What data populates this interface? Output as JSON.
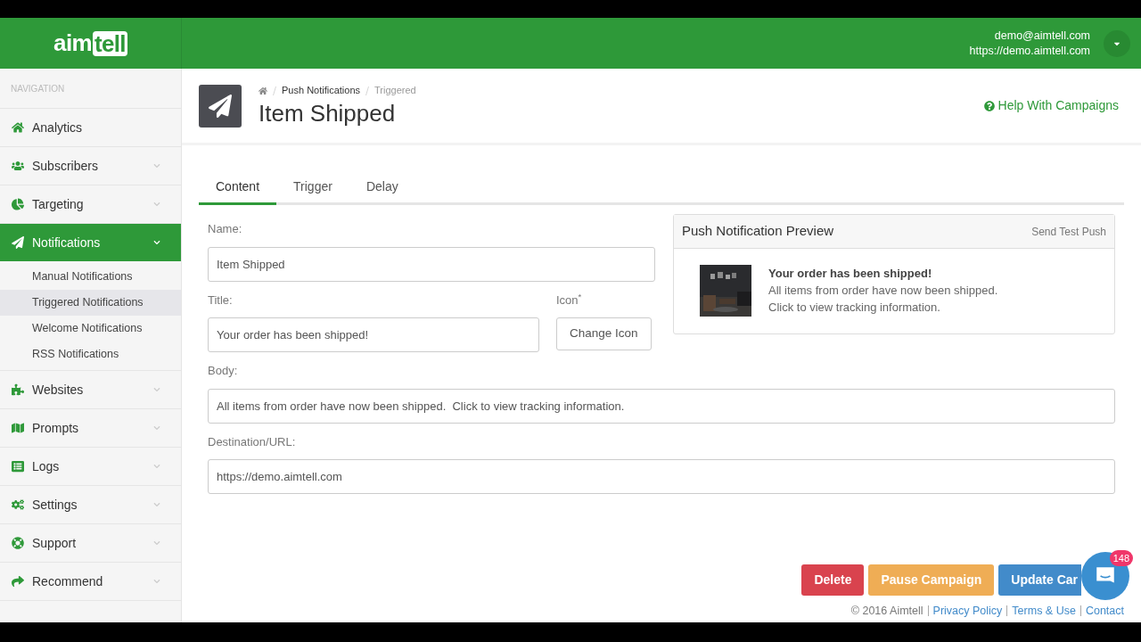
{
  "header": {
    "logo": {
      "part_1": "aim",
      "part_2": "tell"
    },
    "user_email": "demo@aimtell.com",
    "user_site": "https://demo.aimtell.com"
  },
  "sidebar": {
    "heading": "NAVIGATION",
    "items": [
      {
        "label": "Analytics",
        "expandable": false,
        "selected": false
      },
      {
        "label": "Subscribers",
        "expandable": true,
        "selected": false
      },
      {
        "label": "Targeting",
        "expandable": true,
        "selected": false
      },
      {
        "label": "Notifications",
        "expandable": true,
        "selected": true,
        "children": [
          {
            "label": "Manual Notifications",
            "selected": false
          },
          {
            "label": "Triggered Notifications",
            "selected": true
          },
          {
            "label": "Welcome Notifications",
            "selected": false
          },
          {
            "label": "RSS Notifications",
            "selected": false
          }
        ]
      },
      {
        "label": "Websites",
        "expandable": true,
        "selected": false
      },
      {
        "label": "Prompts",
        "expandable": true,
        "selected": false
      },
      {
        "label": "Logs",
        "expandable": true,
        "selected": false
      },
      {
        "label": "Settings",
        "expandable": true,
        "selected": false
      },
      {
        "label": "Support",
        "expandable": true,
        "selected": false
      },
      {
        "label": "Recommend",
        "expandable": true,
        "selected": false
      }
    ]
  },
  "page_header": {
    "breadcrumb": [
      {
        "label": "Push Notifications"
      },
      {
        "label": "Triggered"
      }
    ],
    "title": "Item Shipped",
    "help_link": "Help With Campaigns"
  },
  "tabs": [
    {
      "label": "Content",
      "selected": true
    },
    {
      "label": "Trigger",
      "selected": false
    },
    {
      "label": "Delay",
      "selected": false
    }
  ],
  "form": {
    "name": {
      "label": "Name:",
      "value": "Item Shipped"
    },
    "title": {
      "label": "Title:",
      "value": "Your order has been shipped!"
    },
    "icon": {
      "label": "Icon$^{*}$",
      "button": "Change Icon"
    },
    "body": {
      "label": "Body:",
      "value": "All items from order have now been shipped.  Click to view tracking information."
    },
    "url": {
      "label": "Destination/URL:",
      "value": "https://demo.aimtell.com"
    }
  },
  "preview": {
    "title": "Push Notification Preview",
    "action": "Send Test Push",
    "image": {
      "kind": "picture"
    },
    "notification_title": "Your order has been shipped!",
    "body_lines": [
      "All items from order have now been shipped.",
      "Click to view tracking information."
    ]
  },
  "actions": [
    "Delete",
    "Pause Campaign",
    "Update Car"
  ],
  "chat": {
    "badge": "148"
  },
  "footer": {
    "copyright": "© 2016 Aimtell",
    "links": [
      "Privacy Policy",
      "Terms & Use",
      "Contact"
    ]
  }
}
